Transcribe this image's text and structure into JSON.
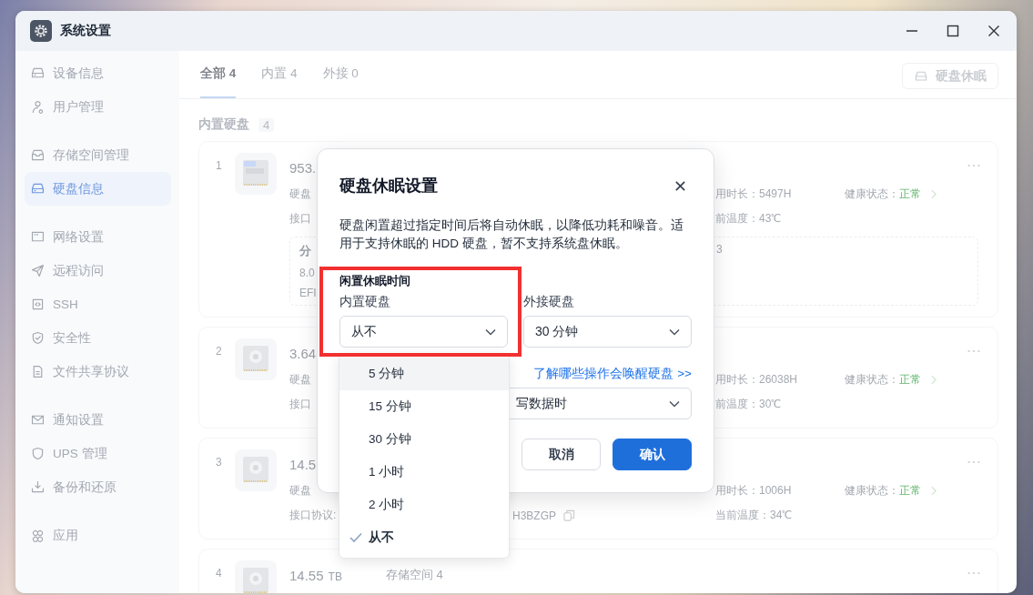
{
  "window": {
    "title": "系统设置"
  },
  "sidebar": {
    "groups": [
      [
        {
          "label": "设备信息",
          "selected": false
        },
        {
          "label": "用户管理",
          "selected": false
        }
      ],
      [
        {
          "label": "存储空间管理",
          "selected": false
        },
        {
          "label": "硬盘信息",
          "selected": true
        }
      ],
      [
        {
          "label": "网络设置",
          "selected": false
        },
        {
          "label": "远程访问",
          "selected": false
        },
        {
          "label": "SSH",
          "selected": false
        },
        {
          "label": "安全性",
          "selected": false
        },
        {
          "label": "文件共享协议",
          "selected": false
        }
      ],
      [
        {
          "label": "通知设置",
          "selected": false
        },
        {
          "label": "UPS 管理",
          "selected": false
        },
        {
          "label": "备份和还原",
          "selected": false
        }
      ],
      [
        {
          "label": "应用",
          "selected": false
        }
      ]
    ]
  },
  "tabs": [
    {
      "label": "全部 4",
      "selected": true
    },
    {
      "label": "内置 4",
      "selected": false
    },
    {
      "label": "外接 0",
      "selected": false
    }
  ],
  "toolbar_button": "硬盘休眠",
  "section": {
    "title": "内置硬盘",
    "count": "4"
  },
  "cards": [
    {
      "number": "1",
      "kind": "ssd",
      "capacity": "953.",
      "type_label": "硬盘",
      "interface_label": "接口",
      "usage": "用时长：5497H",
      "health_label": "健康状态：",
      "health_value": "正常",
      "temperature": "前温度：43℃",
      "partition": {
        "title": "分",
        "size": "8.0",
        "name": "EFI",
        "column_2": "3"
      }
    },
    {
      "number": "2",
      "kind": "hdd",
      "capacity": "3.64",
      "type_label": "硬盘",
      "interface_label": "接口",
      "usage": "用时长：26038H",
      "health_label": "健康状态：",
      "health_value": "正常",
      "temperature": "前温度：30℃"
    },
    {
      "number": "3",
      "kind": "hdd",
      "capacity": "14.5",
      "type_label": "硬盘",
      "interface_label": "接口协议:",
      "serial": "H3BZGP",
      "usage": "用时长：1006H",
      "health_label": "健康状态：",
      "health_value": "正常",
      "temperature": "当前温度：34℃"
    },
    {
      "number": "4",
      "kind": "hdd",
      "capacity": "14.55",
      "unit": "TB",
      "storage": "存储空间 4"
    }
  ],
  "dialog": {
    "title": "硬盘休眠设置",
    "description": "硬盘闲置超过指定时间后将自动休眠，以降低功耗和噪音。适用于支持休眠的 HDD 硬盘，暂不支持系统盘休眠。",
    "section_title": "闲置休眠时间",
    "internal": {
      "label": "内置硬盘",
      "value": "从不"
    },
    "external": {
      "label": "外接硬盘",
      "value": "30 分钟"
    },
    "link": "了解哪些操作会唤醒硬盘 >>",
    "wake": {
      "value": "写数据时"
    },
    "buttons": [
      {
        "label": "取消",
        "kind": "secondary"
      },
      {
        "label": "确认",
        "kind": "primary"
      }
    ]
  },
  "dropdown": {
    "options": [
      {
        "label": "5 分钟",
        "highlighted": true,
        "selected": false
      },
      {
        "label": "15 分钟",
        "highlighted": false,
        "selected": false
      },
      {
        "label": "30 分钟",
        "highlighted": false,
        "selected": false
      },
      {
        "label": "1 小时",
        "highlighted": false,
        "selected": false
      },
      {
        "label": "2 小时",
        "highlighted": false,
        "selected": false
      },
      {
        "label": "从不",
        "highlighted": false,
        "selected": true
      }
    ]
  }
}
